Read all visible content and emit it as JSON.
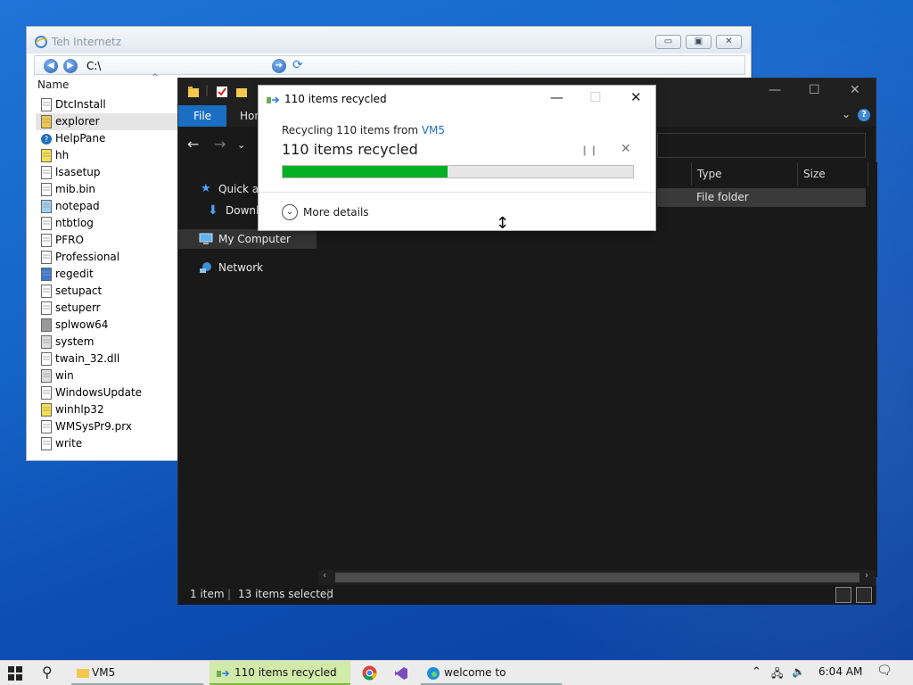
{
  "browser": {
    "title": "Teh Internetz",
    "address": "C:\\",
    "column_header": "Name",
    "files": [
      {
        "name": "DtcInstall",
        "icon": "document-icon"
      },
      {
        "name": "explorer",
        "icon": "folder-app-icon"
      },
      {
        "name": "HelpPane",
        "icon": "help-icon"
      },
      {
        "name": "hh",
        "icon": "help-document-icon"
      },
      {
        "name": "lsasetup",
        "icon": "document-icon"
      },
      {
        "name": "mib.bin",
        "icon": "document-icon"
      },
      {
        "name": "notepad",
        "icon": "notepad-icon"
      },
      {
        "name": "ntbtlog",
        "icon": "document-icon"
      },
      {
        "name": "PFRO",
        "icon": "document-icon"
      },
      {
        "name": "Professional",
        "icon": "document-icon"
      },
      {
        "name": "regedit",
        "icon": "regedit-icon"
      },
      {
        "name": "setupact",
        "icon": "document-icon"
      },
      {
        "name": "setuperr",
        "icon": "document-icon"
      },
      {
        "name": "splwow64",
        "icon": "printer-icon"
      },
      {
        "name": "system",
        "icon": "gear-document-icon"
      },
      {
        "name": "twain_32.dll",
        "icon": "document-icon"
      },
      {
        "name": "win",
        "icon": "gear-document-icon"
      },
      {
        "name": "WindowsUpdate",
        "icon": "document-icon"
      },
      {
        "name": "winhlp32",
        "icon": "help-question-icon"
      },
      {
        "name": "WMSysPr9.prx",
        "icon": "document-icon"
      },
      {
        "name": "write",
        "icon": "write-icon"
      }
    ],
    "selected_file": "explorer"
  },
  "explorer": {
    "ribbon_file": "File",
    "ribbon_home": "Hom",
    "nav_items": [
      {
        "label": "Quick ac",
        "icon": "star-icon"
      },
      {
        "label": "Downlo",
        "icon": "download-icon"
      },
      {
        "label": "My Computer",
        "icon": "computer-icon"
      },
      {
        "label": "Network",
        "icon": "network-icon"
      }
    ],
    "columns": {
      "type": "Type",
      "size": "Size"
    },
    "row_type": "File folder",
    "status_items": "1 item",
    "status_selected": "13 items selected"
  },
  "dialog": {
    "title": "110 items recycled",
    "subtitle_prefix": "Recycling 110 items from ",
    "subtitle_source": "VM5",
    "main_text": "110 items recycled",
    "progress_fraction": 0.47,
    "more_details": "More details"
  },
  "taskbar": {
    "items": [
      {
        "label": "VM5"
      },
      {
        "label": "110 items recycled"
      },
      {
        "label": "welcome to obama.w..."
      }
    ],
    "time": "6:04 AM"
  },
  "colors": {
    "progress": "#06b025",
    "file_tab": "#1a6fc2",
    "link": "#1f6fbf"
  }
}
